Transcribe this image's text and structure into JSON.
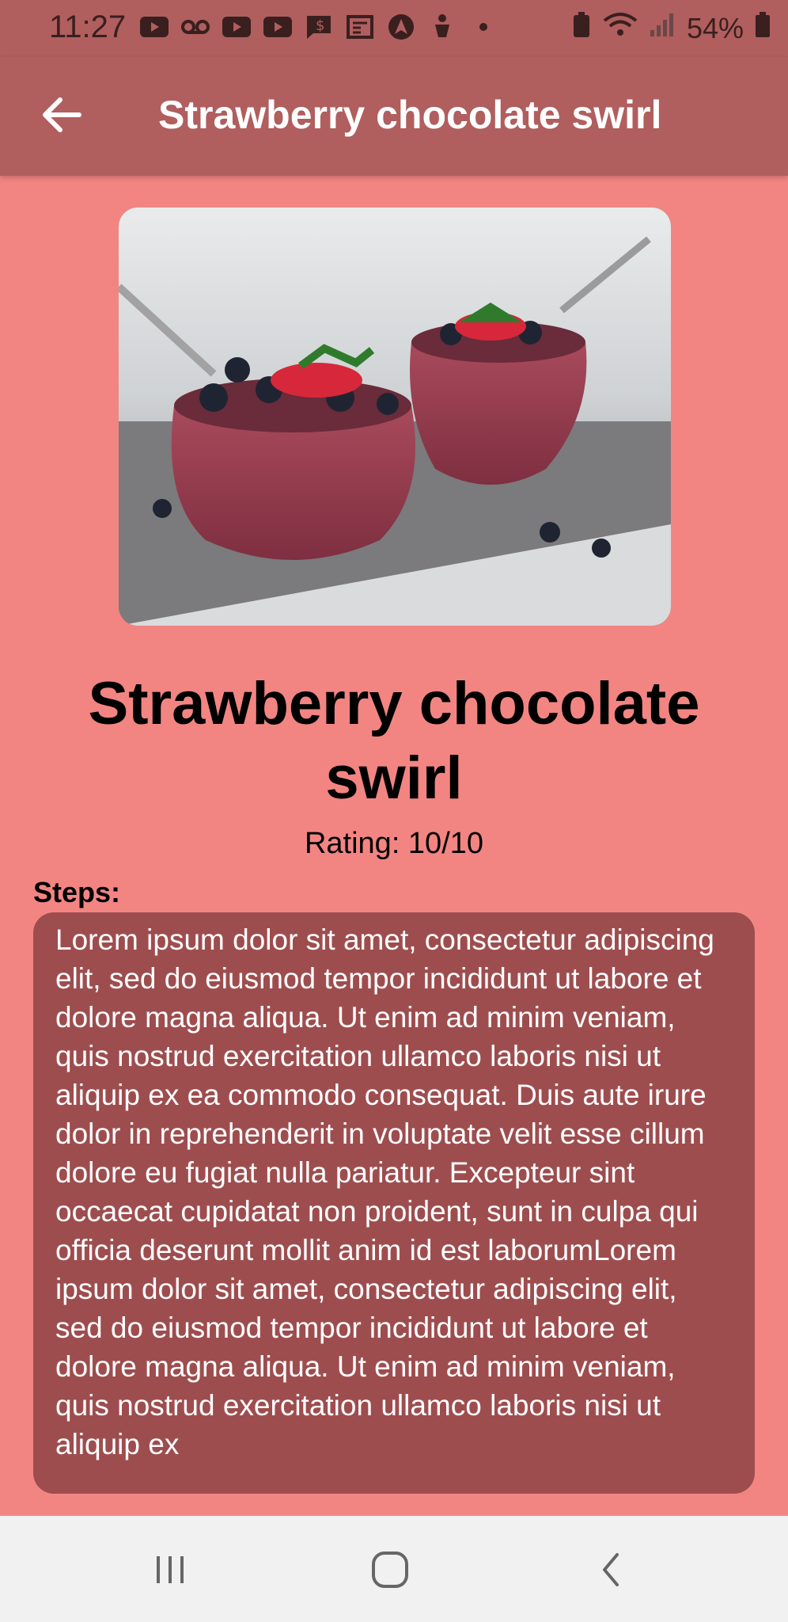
{
  "status_bar": {
    "time": "11:27",
    "battery": "54%",
    "left_icons": [
      "youtube-icon",
      "voicemail-icon",
      "youtube-icon",
      "youtube-icon",
      "money-message-icon",
      "news-icon",
      "vpn-icon",
      "accessibility-icon",
      "dot-icon"
    ],
    "right_icons": [
      "battery-saver-icon",
      "wifi-icon",
      "signal-icon",
      "battery-icon"
    ]
  },
  "app_bar": {
    "title": "Strawberry chocolate swirl",
    "back_icon": "arrow-left-icon"
  },
  "recipe": {
    "image_alt": "Strawberry blueberry smoothie in glass cups",
    "title": "Strawberry chocolate swirl",
    "rating": "Rating: 10/10",
    "steps_label": "Steps:",
    "steps_text": "Lorem ipsum dolor sit amet, consectetur adipiscing elit, sed do eiusmod tempor incididunt ut labore et dolore magna aliqua. Ut enim ad minim veniam, quis nostrud exercitation ullamco laboris nisi ut aliquip ex ea commodo consequat. Duis aute irure dolor in reprehenderit in voluptate velit esse cillum dolore eu fugiat nulla pariatur. Excepteur sint occaecat cupidatat non proident, sunt in culpa qui officia deserunt mollit anim id est laborumLorem ipsum dolor sit amet, consectetur adipiscing elit, sed do eiusmod tempor incididunt ut labore et dolore magna aliqua. Ut enim ad minim veniam, quis nostrud exercitation ullamco laboris nisi ut aliquip ex"
  },
  "colors": {
    "background": "#f28582",
    "app_bar": "#b05e5e",
    "steps_box": "#9e4d4f",
    "nav_bar": "#f1f1f1"
  },
  "nav_bar": {
    "icons": [
      "recent-apps-icon",
      "home-icon",
      "back-icon"
    ]
  }
}
